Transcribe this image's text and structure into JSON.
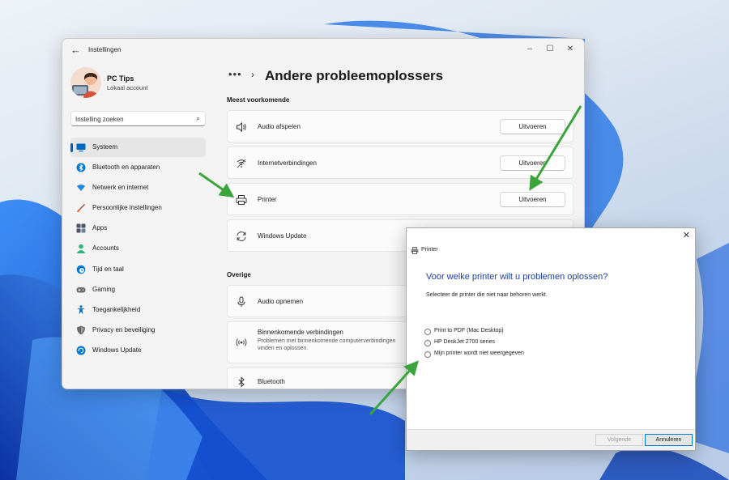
{
  "settings_window": {
    "title": "Instellingen",
    "controls": {
      "minimize": "–",
      "maximize": "☐",
      "close": "✕"
    },
    "user": {
      "name": "PC Tips",
      "account": "Lokaal account"
    },
    "search": {
      "placeholder": "Instelling zoeken"
    },
    "nav": [
      {
        "label": "Systeem",
        "icon": "system-icon",
        "color": "#0067c0",
        "active": true
      },
      {
        "label": "Bluetooth en apparaten",
        "icon": "bluetooth-icon",
        "color": "#0078d4"
      },
      {
        "label": "Netwerk en internet",
        "icon": "network-icon",
        "color": "#1e88e5"
      },
      {
        "label": "Persoonlijke instellingen",
        "icon": "brush-icon",
        "color": "#e65c2a"
      },
      {
        "label": "Apps",
        "icon": "apps-icon",
        "color": "#4a5568"
      },
      {
        "label": "Accounts",
        "icon": "accounts-icon",
        "color": "#2eb67d"
      },
      {
        "label": "Tijd en taal",
        "icon": "clock-globe-icon",
        "color": "#0078d4"
      },
      {
        "label": "Gaming",
        "icon": "gamepad-icon",
        "color": "#6b6b6b"
      },
      {
        "label": "Toegankelijkheid",
        "icon": "accessibility-icon",
        "color": "#0067c0"
      },
      {
        "label": "Privacy en beveiliging",
        "icon": "shield-icon",
        "color": "#6b6b6b"
      },
      {
        "label": "Windows Update",
        "icon": "windows-update-icon",
        "color": "#0078d4"
      }
    ],
    "breadcrumb": {
      "more": "•••",
      "separator": "›",
      "title": "Andere probleemoplossers"
    },
    "section_common": "Meest voorkomende",
    "common_items": [
      {
        "label": "Audio afspelen",
        "icon": "speaker-icon",
        "button": "Uitvoeren"
      },
      {
        "label": "Internetverbindingen",
        "icon": "wifi-icon",
        "button": "Uitvoeren"
      },
      {
        "label": "Printer",
        "icon": "printer-icon",
        "button": "Uitvoeren"
      },
      {
        "label": "Windows Update",
        "icon": "refresh-icon"
      }
    ],
    "section_other": "Overige",
    "other_items": [
      {
        "label": "Audio opnemen",
        "icon": "microphone-icon"
      },
      {
        "label": "Binnenkomende verbindingen",
        "description": "Problemen met binnenkomende computerverbindingen vinden en oplossen.",
        "icon": "incoming-connections-icon"
      },
      {
        "label": "Bluetooth",
        "icon": "bluetooth-icon"
      }
    ]
  },
  "printer_dialog": {
    "title": "Printer",
    "close": "✕",
    "heading": "Voor welke printer wilt u problemen oplossen?",
    "description": "Selecteer de printer die niet naar behoren werkt.",
    "options": [
      "Print to PDF (Mac Desktop)",
      "HP DeskJet 2700 series",
      "Mijn printer wordt niet weergegeven"
    ],
    "next_button": "Volgende",
    "cancel_button": "Annuleren"
  },
  "colors": {
    "accent": "#005fb8",
    "annotation_arrow": "#3aa53a",
    "dialog_heading": "#1f3f9a"
  }
}
